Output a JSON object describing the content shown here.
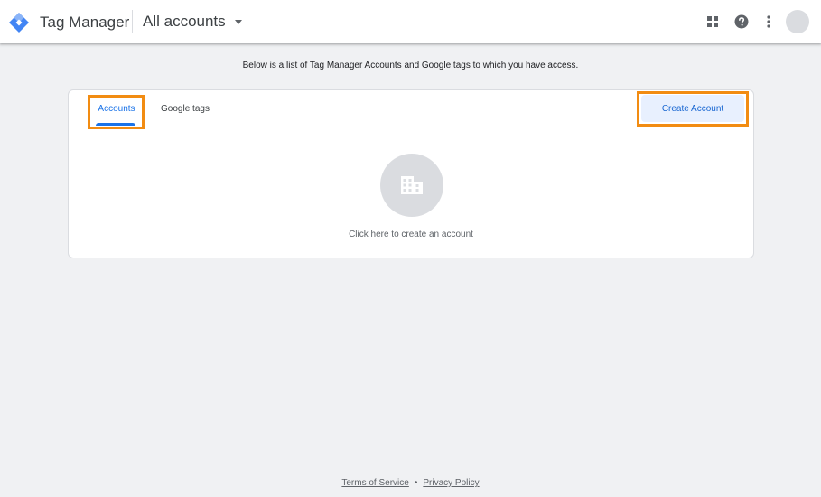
{
  "header": {
    "product_name": "Tag Manager",
    "account_picker_label": "All accounts",
    "icons": {
      "logo": "tag-manager-logo",
      "apps": "apps-grid-icon",
      "help": "help-icon",
      "more": "more-vert-icon"
    }
  },
  "main": {
    "intro_text": "Below is a list of Tag Manager Accounts and Google tags to which you have access.",
    "tabs": [
      {
        "label": "Accounts",
        "active": true
      },
      {
        "label": "Google tags",
        "active": false
      }
    ],
    "create_button_label": "Create Account",
    "empty_state": {
      "icon": "building-icon",
      "text": "Click here to create an account"
    }
  },
  "footer": {
    "links": [
      "Terms of Service",
      "Privacy Policy"
    ],
    "separator": "•"
  },
  "colors": {
    "accent": "#1a73e8",
    "highlight_outline": "#f28c12",
    "button_bg": "#e8f0fe",
    "page_bg": "#f0f1f3"
  }
}
